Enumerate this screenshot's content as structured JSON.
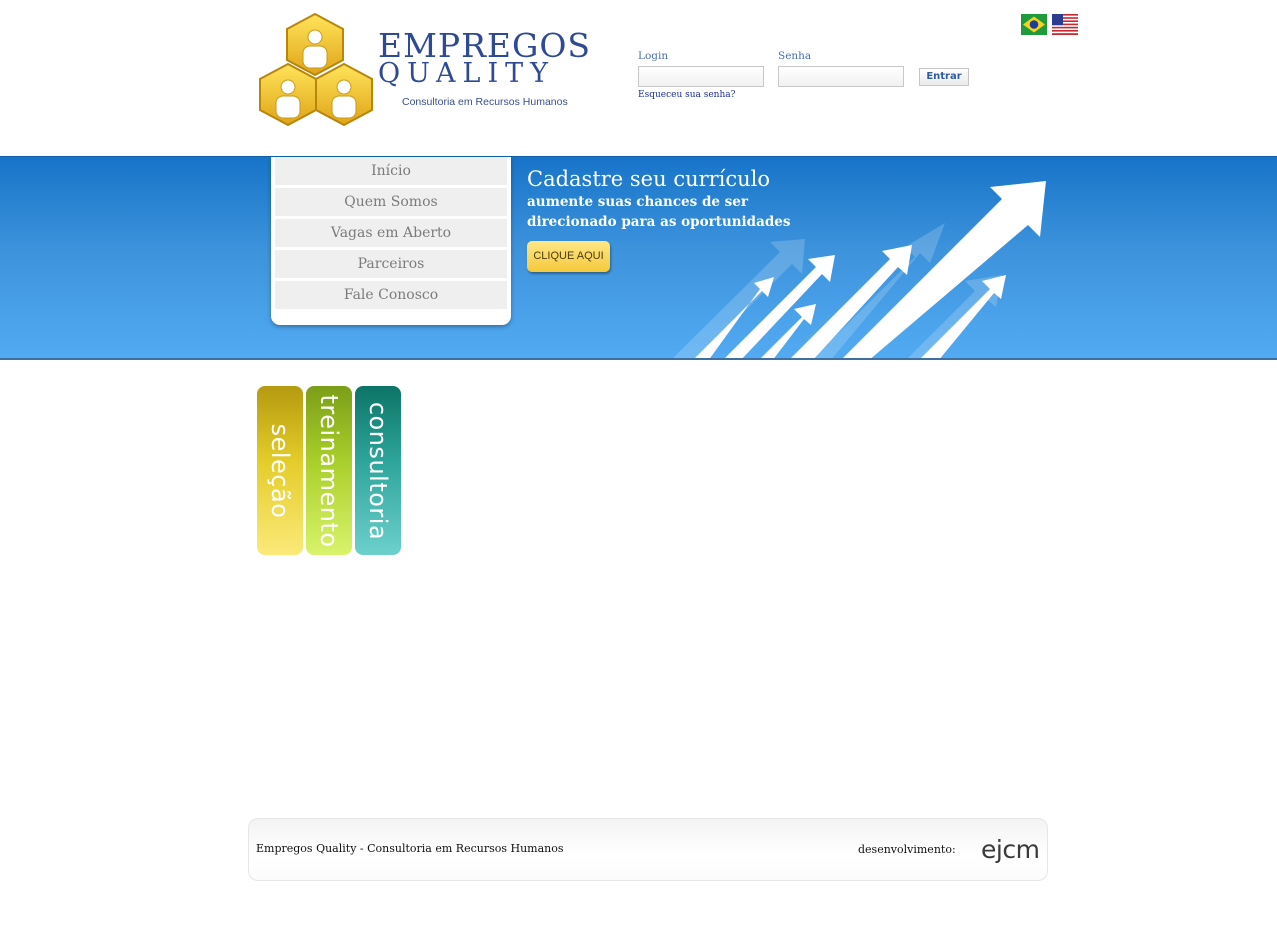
{
  "header": {
    "brand_line1": "EMPREGOS",
    "brand_line2": "QUALITY",
    "tagline": "Consultoria em Recursos Humanos",
    "logo_icon": "people-hexagons-icon",
    "flags": [
      "brazil-flag-icon",
      "usa-flag-icon"
    ]
  },
  "login": {
    "login_label": "Login",
    "password_label": "Senha",
    "submit_label": "Entrar",
    "forgot_link": "Esqueceu sua senha?",
    "login_value": "",
    "password_value": ""
  },
  "nav": {
    "items": [
      {
        "label": "Início"
      },
      {
        "label": "Quem Somos"
      },
      {
        "label": "Vagas em Aberto"
      },
      {
        "label": "Parceiros"
      },
      {
        "label": "Fale Conosco"
      }
    ]
  },
  "promo": {
    "title": "Cadastre seu currículo",
    "line1": "aumente suas chances de ser",
    "line2": "direcionado para as oportunidades",
    "button": "CLIQUE AQUI",
    "decor_icon": "rising-arrows-icon"
  },
  "tabs": [
    {
      "label": "seleção"
    },
    {
      "label": "treinamento"
    },
    {
      "label": "consultoria"
    }
  ],
  "footer": {
    "company": "Empregos Quality - Consultoria em Recursos Humanos",
    "dev_label": "desenvolvimento:",
    "dev_logo": "ejcm"
  },
  "colors": {
    "banner_top": "#1774c8",
    "banner_bottom": "#52abf2",
    "brand_blue": "#2f4a95",
    "tab_selecao": "#e4cd2a",
    "tab_treinamento": "#a9cf2b",
    "tab_consultoria": "#2ea59b",
    "cta_yellow": "#f4c93a"
  }
}
